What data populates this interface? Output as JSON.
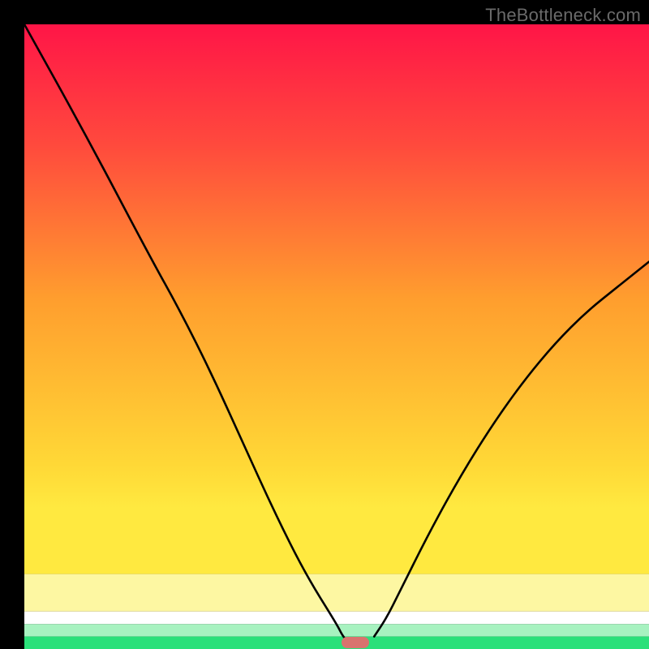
{
  "watermark": "TheBottleneck.com",
  "chart_data": {
    "type": "line",
    "title": "",
    "xlabel": "",
    "ylabel": "",
    "xlim": [
      0,
      100
    ],
    "ylim": [
      0,
      100
    ],
    "grid": false,
    "legend": false,
    "series": [
      {
        "name": "left-curve",
        "x": [
          0,
          10,
          20,
          25,
          30,
          35,
          40,
          45,
          50,
          51,
          52
        ],
        "values": [
          100,
          82,
          63,
          54,
          44,
          33,
          22,
          12,
          4,
          2,
          1
        ]
      },
      {
        "name": "right-curve",
        "x": [
          56,
          58,
          60,
          65,
          70,
          75,
          80,
          85,
          90,
          95,
          100
        ],
        "values": [
          2,
          5,
          9,
          19,
          28,
          36,
          43,
          49,
          54,
          58,
          62
        ]
      }
    ],
    "bands": [
      {
        "name": "red-orange-yellow-gradient",
        "y_start": 100,
        "y_end": 12,
        "color_top": "#ff1844",
        "color_bottom": "#ffe940"
      },
      {
        "name": "pale-yellow",
        "y_start": 12,
        "y_end": 6,
        "color": "#fdf7a2"
      },
      {
        "name": "white",
        "y_start": 6,
        "y_end": 4,
        "color": "#ffffff"
      },
      {
        "name": "pale-green",
        "y_start": 4,
        "y_end": 2,
        "color": "#a7f2c0"
      },
      {
        "name": "green",
        "y_start": 2,
        "y_end": 0,
        "color": "#2be07a"
      }
    ],
    "marker": {
      "x": 53,
      "y": 1,
      "shape": "pill",
      "color": "#d9736e"
    }
  }
}
